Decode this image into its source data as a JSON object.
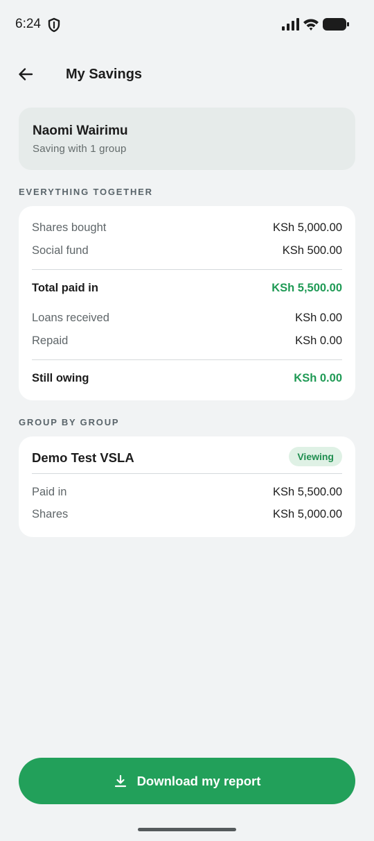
{
  "status_bar": {
    "time": "6:24",
    "icons": [
      "shield-icon",
      "signal-icon",
      "wifi-icon",
      "battery-icon"
    ]
  },
  "header": {
    "title": "My Savings",
    "back_icon": "arrow-back-icon"
  },
  "profile": {
    "name": "Naomi Wairimu",
    "subtitle": "Saving with 1 group"
  },
  "summary": {
    "section_label": "EVERYTHING TOGETHER",
    "shares_bought": {
      "label": "Shares bought",
      "value": "KSh 5,000.00"
    },
    "social_fund": {
      "label": "Social fund",
      "value": "KSh 500.00"
    },
    "total_paid_in": {
      "label": "Total paid in",
      "value": "KSh 5,500.00"
    },
    "loans_received": {
      "label": "Loans received",
      "value": "KSh 0.00"
    },
    "repaid": {
      "label": "Repaid",
      "value": "KSh 0.00"
    },
    "still_owing": {
      "label": "Still owing",
      "value": "KSh 0.00"
    }
  },
  "groups": {
    "section_label": "GROUP BY GROUP",
    "items": [
      {
        "name": "Demo Test VSLA",
        "badge": "Viewing",
        "paid_in": {
          "label": "Paid in",
          "value": "KSh 5,500.00"
        },
        "shares": {
          "label": "Shares",
          "value": "KSh 5,000.00"
        }
      }
    ]
  },
  "actions": {
    "download_label": "Download my report",
    "download_icon": "download-icon"
  },
  "colors": {
    "accent": "#22a05a",
    "accent_text": "#1f9a55",
    "background": "#f1f3f4",
    "card": "#ffffff",
    "profile_card": "#e6ebea",
    "badge_bg": "#dff1e5"
  }
}
